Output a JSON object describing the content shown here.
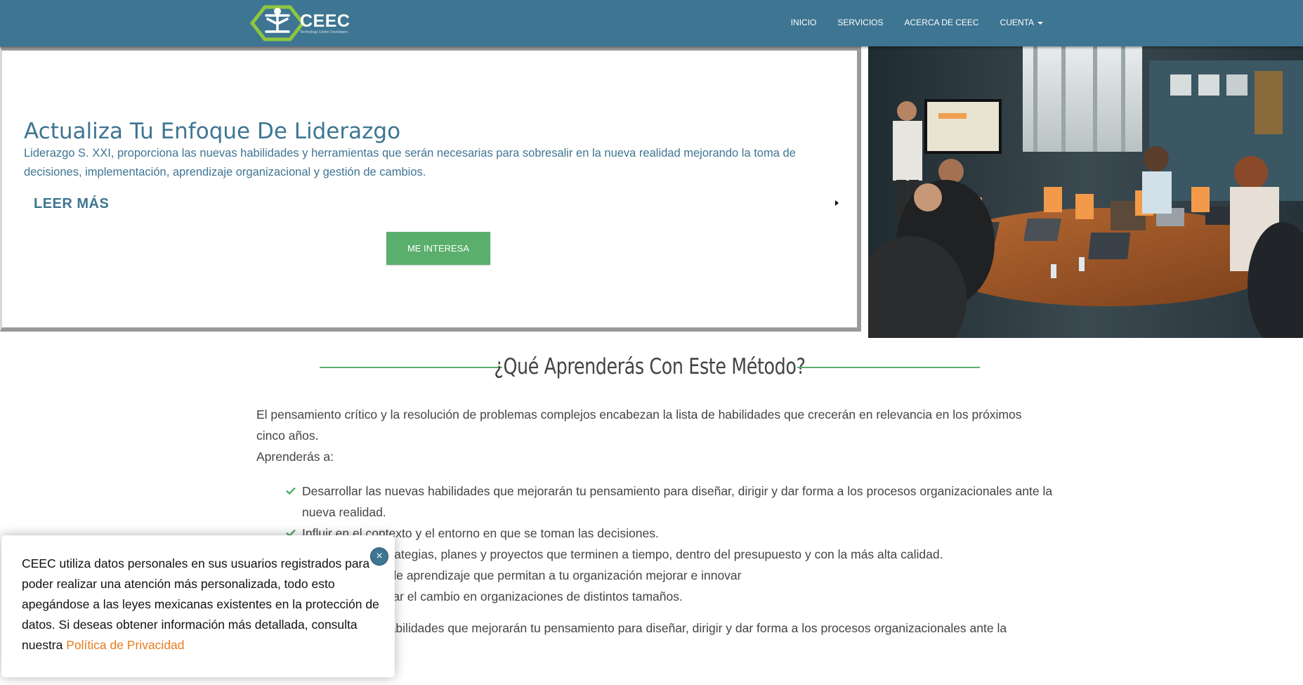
{
  "navbar": {
    "logo_text": "CEEC",
    "logo_subtext": "Technology Center Developers",
    "links": [
      "INICIO",
      "SERVICIOS",
      "ACERCA DE CEEC",
      "CUENTA"
    ]
  },
  "hero": {
    "title": "Actualiza Tu Enfoque De Liderazgo",
    "description": "Liderazgo S. XXI, proporciona las nuevas habilidades y herramientas que serán necesarias para sobresalir en la nueva realidad mejorando la toma de decisiones, implementación, aprendizaje organizacional y gestión de cambios.",
    "read_more": "LEER MÁS",
    "button": "ME INTERESA"
  },
  "section": {
    "title": "¿Qué Aprenderás Con Este Método?",
    "intro": "El pensamiento crítico y la resolución de problemas complejos encabezan la lista de habilidades que crecerán en relevancia en los próximos cinco años.",
    "learn_label": "Aprenderás a:",
    "items": [
      "Desarrollar las nuevas habilidades que mejorarán tu pensamiento para diseñar, dirigir y dar forma a los procesos organizacionales ante la nueva realidad.",
      "Influir en el contexto y el entorno en que se toman las decisiones.",
      "Implementar estrategias, planes y proyectos que terminen a tiempo, dentro del presupuesto y con la más alta calidad.",
      "Crear procesos de aprendizaje que permitan a tu organización mejorar e innovar",
      "Liderar y gestionar el cambio en organizaciones de distintos tamaños."
    ],
    "summary": "Desarrollar las nuevas habilidades que mejorarán tu pensamiento para diseñar, dirigir y dar forma a los procesos organizacionales ante la"
  },
  "cookie": {
    "text": "CEEC utiliza datos personales en sus usuarios registrados para poder realizar una atención más personalizada, todo esto apegándose a las leyes mexicanas existentes en la protección de datos. Si deseas obtener información más detallada, consulta nuestra ",
    "link": "Política de Privacidad",
    "close": "×"
  },
  "colors": {
    "nav_bg": "#3e7592",
    "accent_green": "#5baf6c",
    "link_orange": "#e87d1e"
  }
}
